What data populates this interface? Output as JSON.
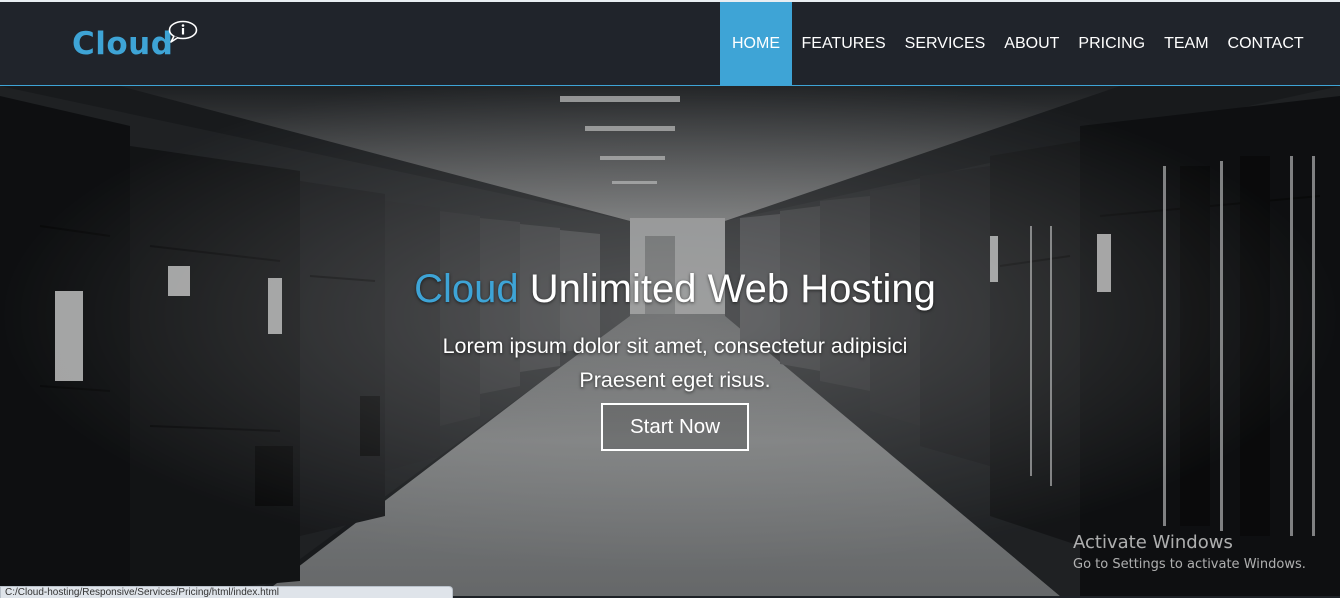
{
  "brand": {
    "name": "Cloud",
    "accent_color": "#3ea4d6",
    "badge_icon": "info-speech-bubble-icon"
  },
  "nav": {
    "items": [
      {
        "label": "HOME",
        "active": true
      },
      {
        "label": "FEATURES",
        "active": false
      },
      {
        "label": "SERVICES",
        "active": false
      },
      {
        "label": "ABOUT",
        "active": false
      },
      {
        "label": "PRICING",
        "active": false
      },
      {
        "label": "TEAM",
        "active": false
      },
      {
        "label": "CONTACT",
        "active": false
      }
    ]
  },
  "hero": {
    "background": "grayscale data center server corridor photo",
    "headline_accent": "Cloud",
    "headline_rest": " Unlimited Web Hosting",
    "subtitle_line1": "Lorem ipsum dolor sit amet, consectetur adipisici",
    "subtitle_line2": "Praesent eget risus.",
    "cta_label": "Start Now"
  },
  "os_overlay": {
    "watermark_title": "Activate Windows",
    "watermark_subtitle": "Go to Settings to activate Windows."
  },
  "status_bar": {
    "url": "C:/Cloud-hosting/Responsive/Services/Pricing/html/index.html"
  }
}
